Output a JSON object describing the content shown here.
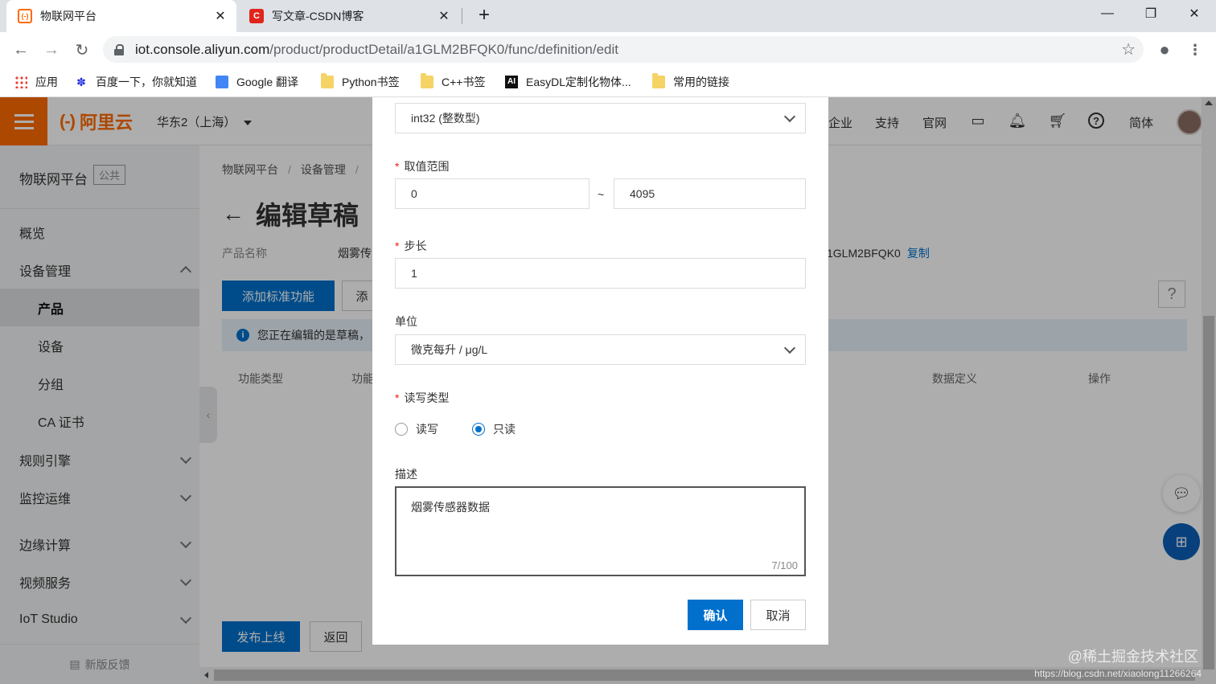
{
  "browser": {
    "tabs": [
      {
        "title": "物联网平台",
        "active": true,
        "favicon": "aliyun-icon"
      },
      {
        "title": "写文章-CSDN博客",
        "active": false,
        "favicon": "csdn-icon"
      }
    ],
    "url": {
      "host": "iot.console.aliyun.com",
      "path": "/product/productDetail/a1GLM2BFQK0/func/definition/edit"
    },
    "bookmarks": [
      {
        "label": "应用",
        "icon": "apps-grid-icon"
      },
      {
        "label": "百度一下，你就知道",
        "icon": "baidu-icon"
      },
      {
        "label": "Google 翻译",
        "icon": "translate-icon"
      },
      {
        "label": "Python书签",
        "icon": "folder-icon"
      },
      {
        "label": "C++书签",
        "icon": "folder-icon"
      },
      {
        "label": "EasyDL定制化物体...",
        "icon": "ai-icon"
      },
      {
        "label": "常用的链接",
        "icon": "folder-icon"
      }
    ]
  },
  "topnav": {
    "logo_text": "阿里云",
    "logo_bracket": "(-)",
    "region": "华东2（上海）",
    "links": [
      "企业",
      "支持",
      "官网"
    ],
    "lang": "简体"
  },
  "sidebar": {
    "title": "物联网平台",
    "badge": "公共",
    "items": [
      {
        "label": "概览"
      },
      {
        "label": "设备管理"
      },
      {
        "label": "产品"
      },
      {
        "label": "设备"
      },
      {
        "label": "分组"
      },
      {
        "label": "CA 证书"
      },
      {
        "label": "规则引擎"
      },
      {
        "label": "监控运维"
      },
      {
        "label": "边缘计算"
      },
      {
        "label": "视频服务"
      },
      {
        "label": "IoT Studio"
      }
    ],
    "feedback": "新版反馈"
  },
  "main": {
    "breadcrumb": [
      "物联网平台",
      "设备管理"
    ],
    "breadcrumb_sep": "/",
    "title": "编辑草稿",
    "product_name_label": "产品名称",
    "product_name_value": "烟雾传",
    "product_key_fragment": "1GLM2BFQK0",
    "copy_label": "复制",
    "add_std_btn": "添加标准功能",
    "add_custom_btn": "添",
    "info_text": "您正在编辑的是草稿，",
    "table_headers": [
      "功能类型",
      "功能",
      "数据定义",
      "操作"
    ],
    "publish_btn": "发布上线",
    "back_btn": "返回",
    "help": "?"
  },
  "modal": {
    "data_type": "int32 (整数型)",
    "range_label": "取值范围",
    "range_min": "0",
    "range_sep": "~",
    "range_max": "4095",
    "step_label": "步长",
    "step_value": "1",
    "unit_label": "单位",
    "unit_value": "微克每升 / μg/L",
    "rw_label": "读写类型",
    "rw_options": [
      {
        "label": "读写",
        "checked": false
      },
      {
        "label": "只读",
        "checked": true
      }
    ],
    "desc_label": "描述",
    "desc_value": "烟雾传感器数据",
    "desc_counter": "7/100",
    "ok_btn": "确认",
    "cancel_btn": "取消"
  },
  "watermark": {
    "text": "@稀土掘金技术社区",
    "url": "https://blog.csdn.net/xiaolong11266264"
  },
  "colors": {
    "brand_orange": "#ff6a00",
    "primary_blue": "#0070cc",
    "required_red": "#e62412"
  }
}
